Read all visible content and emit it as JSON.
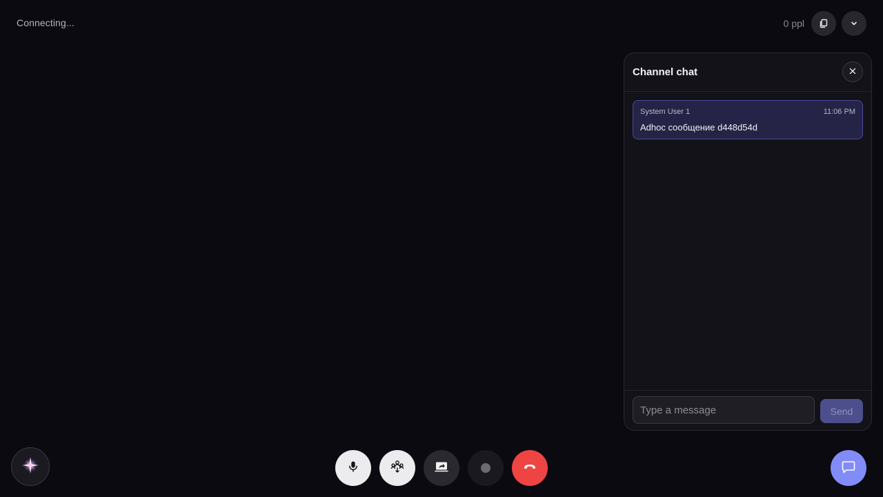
{
  "status": {
    "text": "Connecting..."
  },
  "header": {
    "participants_label": "0 ppl",
    "copy_icon": "copy-icon",
    "collapse_icon": "chevron-down-icon"
  },
  "chat": {
    "title": "Channel chat",
    "close_icon": "close-icon",
    "messages": [
      {
        "author": "System User 1",
        "time": "11:06 PM",
        "text": "Adhoc сообщение d448d54d"
      }
    ],
    "input_placeholder": "Type a message",
    "input_value": "",
    "send_label": "Send"
  },
  "controls": {
    "items": [
      {
        "name": "microphone",
        "icon": "microphone-icon"
      },
      {
        "name": "noise-suppression",
        "icon": "noise-suppression-icon"
      },
      {
        "name": "screen-share",
        "icon": "screen-share-icon"
      },
      {
        "name": "record",
        "icon": "record-dot-icon"
      },
      {
        "name": "leave-call",
        "icon": "hang-up-icon"
      }
    ],
    "ai_icon": "sparkle-icon",
    "chat_toggle_icon": "chat-bubble-icon"
  },
  "colors": {
    "background": "#0b0a10",
    "accent": "#818cf8",
    "hangup": "#ef4444",
    "message_bg": "#252446",
    "message_border": "#4a49a0"
  }
}
